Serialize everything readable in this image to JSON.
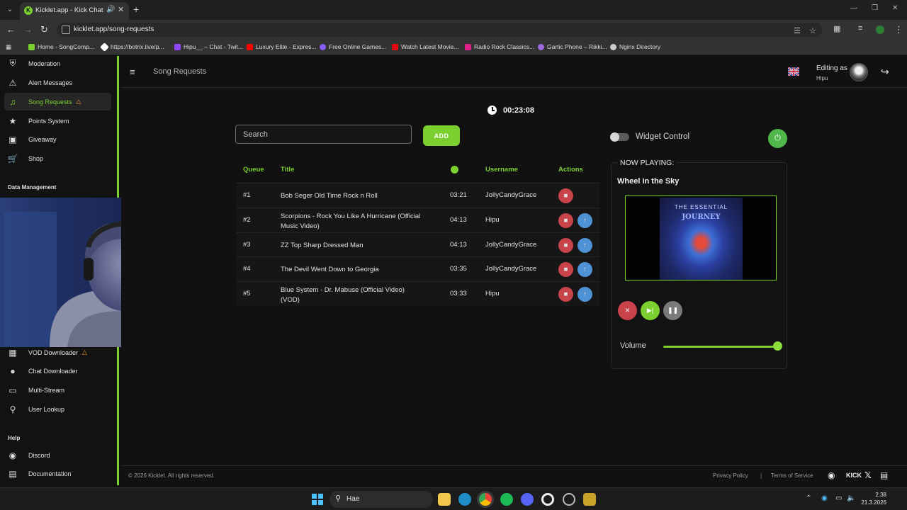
{
  "browser": {
    "tab_title": "Kicklet.app - Kick Chatbot & ...",
    "url": "kicklet.app/song-requests",
    "bookmarks": [
      {
        "label": "Home - SongComp...",
        "color": "#7bcf2e"
      },
      {
        "label": "https://botrix.live/p...",
        "color": "#ffffff"
      },
      {
        "label": "Hipu__ – Chat - Twit...",
        "color": "#9146ff"
      },
      {
        "label": "Luxury Elite - Expres...",
        "color": "#ff0000"
      },
      {
        "label": "Free Online Games...",
        "color": "#8b5cf6"
      },
      {
        "label": "Watch Latest Movie...",
        "color": "#e50914"
      },
      {
        "label": "Radio Rock Classics...",
        "color": "#e0218a"
      },
      {
        "label": "Gartic Phone – Rikki...",
        "color": "#9c6ade"
      },
      {
        "label": "Nginx Directory",
        "color": "#cccccc"
      }
    ]
  },
  "sidebar": {
    "items_top": [
      {
        "label": "Moderation",
        "icon": "shield-icon"
      },
      {
        "label": "Alert Messages",
        "icon": "warning-icon"
      },
      {
        "label": "Song Requests",
        "icon": "music-icon",
        "active": true,
        "hot": true
      },
      {
        "label": "Points System",
        "icon": "star-icon"
      },
      {
        "label": "Giveaway",
        "icon": "gift-icon"
      },
      {
        "label": "Shop",
        "icon": "cart-icon"
      }
    ],
    "data_section": "Data Management",
    "items_data": [
      {
        "label": "VOD Downloader",
        "icon": "clapper-icon",
        "hot": true
      },
      {
        "label": "Chat Downloader",
        "icon": "chat-icon"
      },
      {
        "label": "Multi-Stream",
        "icon": "monitor-icon"
      },
      {
        "label": "User Lookup",
        "icon": "search-icon"
      }
    ],
    "help_section": "Help",
    "items_help": [
      {
        "label": "Discord",
        "icon": "discord-icon"
      },
      {
        "label": "Documentation",
        "icon": "docs-icon"
      }
    ]
  },
  "header": {
    "page_title": "Song Requests",
    "editing_label": "Editing as",
    "editing_user": "Hipu"
  },
  "timer": "00:23:08",
  "search": {
    "placeholder": "Search"
  },
  "add_label": "ADD",
  "queue": {
    "headers": {
      "queue": "Queue",
      "title": "Title",
      "username": "Username",
      "actions": "Actions"
    },
    "rows": [
      {
        "num": "#1",
        "title": "Bob Seger Old Time Rock n Roll",
        "duration": "03:21",
        "user": "JollyCandyGrace",
        "up": false
      },
      {
        "num": "#2",
        "title": "Scorpions - Rock You Like A Hurricane (Official Music Video)",
        "duration": "04:13",
        "user": "Hipu",
        "up": true
      },
      {
        "num": "#3",
        "title": "ZZ Top Sharp Dressed Man",
        "duration": "04:13",
        "user": "JollyCandyGrace",
        "up": true
      },
      {
        "num": "#4",
        "title": "The Devil Went Down to Georgia",
        "duration": "03:35",
        "user": "JollyCandyGrace",
        "up": true
      },
      {
        "num": "#5",
        "title": "Blue System - Dr. Mabuse (Official Video) (VOD)",
        "duration": "03:33",
        "user": "Hipu",
        "up": true
      }
    ]
  },
  "widget": {
    "label": "Widget Control",
    "enabled": false
  },
  "now_playing": {
    "label": "NOW PLAYING:",
    "song": "Wheel in the Sky",
    "cover_top": "THE ESSENTIAL",
    "cover_band": "JOURNEY",
    "volume_label": "Volume",
    "volume": 1.0
  },
  "footer": {
    "copyright": "© 2026 Kicklet. All rights reserved.",
    "privacy": "Privacy Policy",
    "sep": "|",
    "terms": "Terms of Service",
    "kick": "KICK"
  },
  "taskbar": {
    "search_text": "Hae",
    "time": "2.38",
    "date": "21.3.2026"
  },
  "colors": {
    "accent": "#7bcf2e",
    "danger": "#c8434a",
    "info": "#4f93d6"
  }
}
